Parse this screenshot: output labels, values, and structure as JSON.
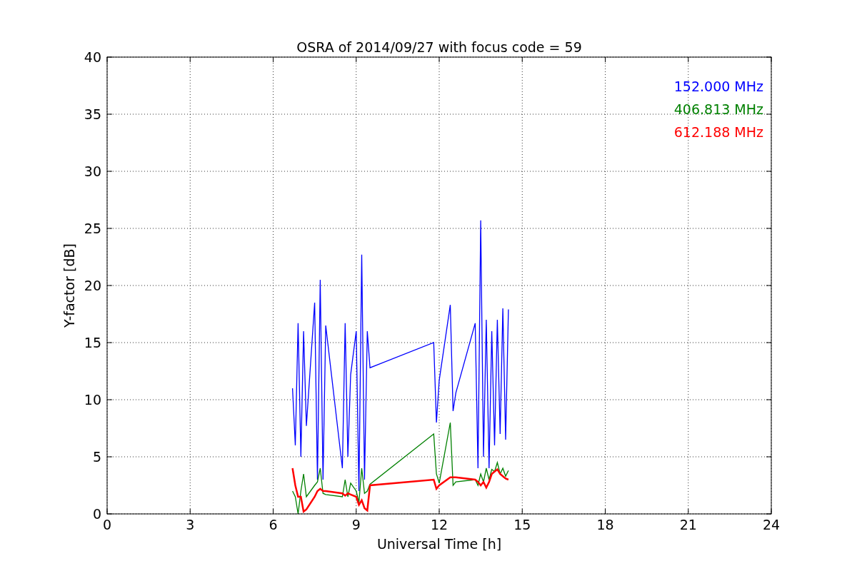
{
  "figure": {
    "chart_data": {
      "type": "line",
      "grid": true,
      "title": "OSRA of 2014/09/27 with focus code = 59",
      "xlabel": "Universal Time [h]",
      "ylabel": "Y-factor [dB]",
      "xlim": [
        0,
        24
      ],
      "ylim": [
        0,
        40
      ],
      "xticks": [
        0,
        3,
        6,
        9,
        12,
        15,
        18,
        21,
        24
      ],
      "yticks": [
        0,
        5,
        10,
        15,
        20,
        25,
        30,
        35,
        40
      ],
      "x": [
        6.7,
        6.8,
        6.9,
        7.0,
        7.1,
        7.2,
        7.5,
        7.6,
        7.7,
        7.8,
        7.9,
        8.5,
        8.6,
        8.7,
        8.8,
        9.0,
        9.1,
        9.2,
        9.3,
        9.4,
        9.5,
        11.8,
        11.9,
        12.0,
        12.4,
        12.5,
        12.6,
        13.3,
        13.4,
        13.5,
        13.6,
        13.7,
        13.8,
        13.9,
        14.0,
        14.1,
        14.2,
        14.3,
        14.4,
        14.5
      ],
      "series": [
        {
          "name": "152.000 MHz",
          "color": "#0000ff",
          "values": [
            11,
            6,
            16.7,
            5,
            16,
            7.7,
            18.5,
            3,
            20.5,
            3,
            16.5,
            4,
            16.7,
            5,
            12.2,
            16,
            2,
            22.7,
            3,
            16,
            12.8,
            15,
            8,
            11.7,
            18.3,
            9,
            10.6,
            16.7,
            4,
            25.7,
            5,
            17,
            4,
            16,
            6,
            17,
            7,
            18,
            6.5,
            17.9
          ]
        },
        {
          "name": "406.813 MHz",
          "color": "#008000",
          "values": [
            2,
            1.5,
            0,
            2,
            3.5,
            1.5,
            2.5,
            2.8,
            4,
            1.8,
            1.7,
            1.5,
            3,
            1.5,
            2.7,
            2,
            1,
            4,
            1.8,
            2,
            2.6,
            7,
            3.5,
            2.7,
            8,
            2.5,
            2.8,
            3,
            2.5,
            3.5,
            2.8,
            4,
            3,
            3.9,
            3.7,
            4.5,
            3.5,
            4,
            3.3,
            3.8
          ]
        },
        {
          "name": "612.188 MHz",
          "color": "#ff0000",
          "values": [
            4,
            2.5,
            1.5,
            1.5,
            0.2,
            0.4,
            1.5,
            2,
            2.2,
            2,
            2,
            1.8,
            1.6,
            1.8,
            1.7,
            1.5,
            0.8,
            1.2,
            0.5,
            0.3,
            2.5,
            3,
            2.2,
            2.5,
            3.2,
            3.2,
            3.2,
            3,
            2.8,
            2.5,
            2.8,
            2.3,
            2.8,
            3.5,
            3.7,
            3.9,
            3.5,
            3.3,
            3.1,
            3
          ]
        }
      ]
    }
  }
}
